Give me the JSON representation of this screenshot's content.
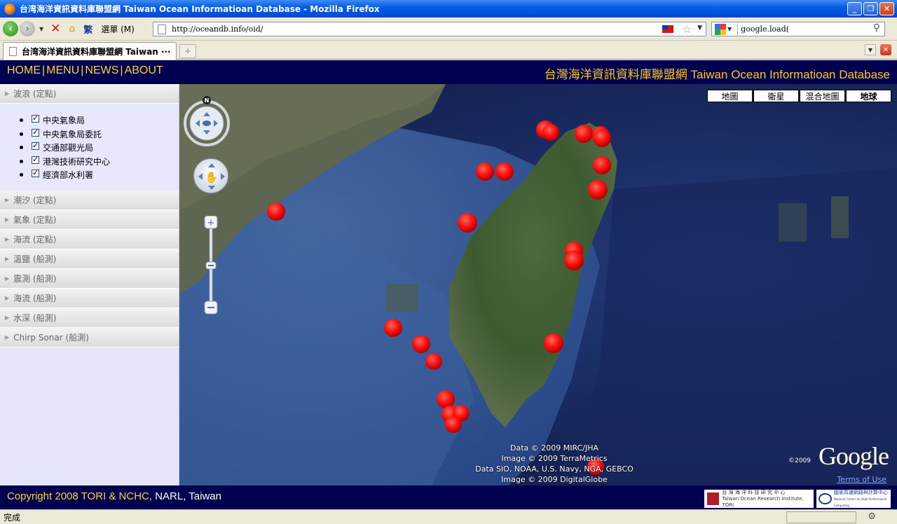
{
  "window": {
    "title": "台湾海洋資訊資料庫聯盟網 Taiwan Ocean Informatioan Database - Mozilla Firefox",
    "minimize": "_",
    "maximize": "❐",
    "close": "✕"
  },
  "toolbar": {
    "back": "‹",
    "forward": "›",
    "stop": "✕",
    "home": "⌂",
    "keyboard": "繁",
    "menu_label": "選單 (M)",
    "url": "http://oceandb.info/oid/",
    "star": "☆",
    "search_value": "google.load(",
    "search_icon": "magnifier-icon"
  },
  "tabs": {
    "active_tab": "台湾海洋資訊資料庫聯盟網 Taiwan ···",
    "new_tab": "+"
  },
  "site": {
    "nav": [
      "HOME",
      "MENU",
      "NEWS",
      "ABOUT"
    ],
    "title_cn": "台灣海洋資訊資料庫聯盟網",
    "title_en": "Taiwan Ocean Informatioan Database"
  },
  "sidebar": {
    "open_section": "波浪 (定點)",
    "open_items": [
      "中央氣象局",
      "中央氣象局委託",
      "交通部觀光局",
      "港灣技術研究中心",
      "經濟部水利署"
    ],
    "sections": [
      "潮汐 (定點)",
      "氣象 (定點)",
      "海流 (定點)",
      "溫鹽 (船測)",
      "震測 (船測)",
      "海流 (船測)",
      "水深 (船測)",
      "Chirp Sonar (船測)"
    ]
  },
  "map": {
    "types": [
      "地圖",
      "衛星",
      "混合地圖",
      "地球"
    ],
    "active_type": "地球",
    "compass": "N",
    "attribution": [
      "Data © 2009 MIRC/JHA",
      "Image © 2009 TerraMetrics",
      "Data SIO, NOAA, U.S. Navy, NGA, GEBCO",
      "Image © 2009 DigitalGlobe"
    ],
    "google_logo": "Google",
    "google_copy": "©2009",
    "terms": "Terms of Use",
    "marker_color": "#ff1010"
  },
  "footer": {
    "copyright_prefix": "Copyright 2008 TORI & NCHC, ",
    "copyright_narl": "NARL",
    "copyright_suffix": ", Taiwan",
    "tori_line1": "台 灣 海 洋 科 技 研 究 中 心",
    "tori_line2": "Taiwan Ocean Research Institute, TORI",
    "nchc_line1": "國家高速網路與計算中心",
    "nchc_line2": "National Center for High-Performance Computing"
  },
  "status": {
    "text": "完成"
  }
}
